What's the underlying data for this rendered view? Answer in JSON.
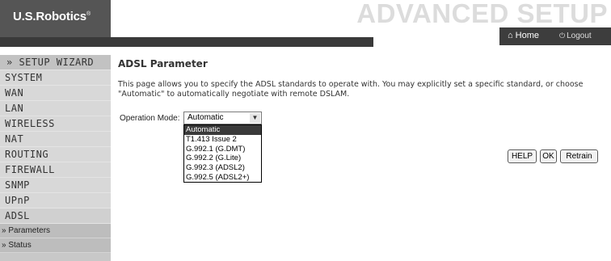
{
  "header": {
    "logo": "U.S.Robotics",
    "logo_mark": "®",
    "banner": "ADVANCED SETUP",
    "home_label": "Home",
    "logout_label": "Logout"
  },
  "sidebar": {
    "wizard": "» SETUP WIZARD",
    "items": [
      "SYSTEM",
      "WAN",
      "LAN",
      "WIRELESS",
      "NAT",
      "ROUTING",
      "FIREWALL",
      "SNMP",
      "UPnP",
      "ADSL"
    ],
    "subitems": [
      "» Parameters",
      "» Status"
    ]
  },
  "main": {
    "title": "ADSL Parameter",
    "description": "This page allows you to specify the ADSL standards to operate with. You may explicitly set a specific standard, or choose \"Automatic\" to automatically negotiate with remote DSLAM.",
    "operation_mode_label": "Operation Mode:",
    "operation_mode_value": "Automatic",
    "options": [
      "Automatic",
      "T1.413 Issue 2",
      "G.992.1 (G.DMT)",
      "G.992.2 (G.Lite)",
      "G.992.3 (ADSL2)",
      "G.992.5 (ADSL2+)"
    ]
  },
  "buttons": {
    "help": "HELP",
    "ok": "OK",
    "retrain": "Retrain"
  }
}
